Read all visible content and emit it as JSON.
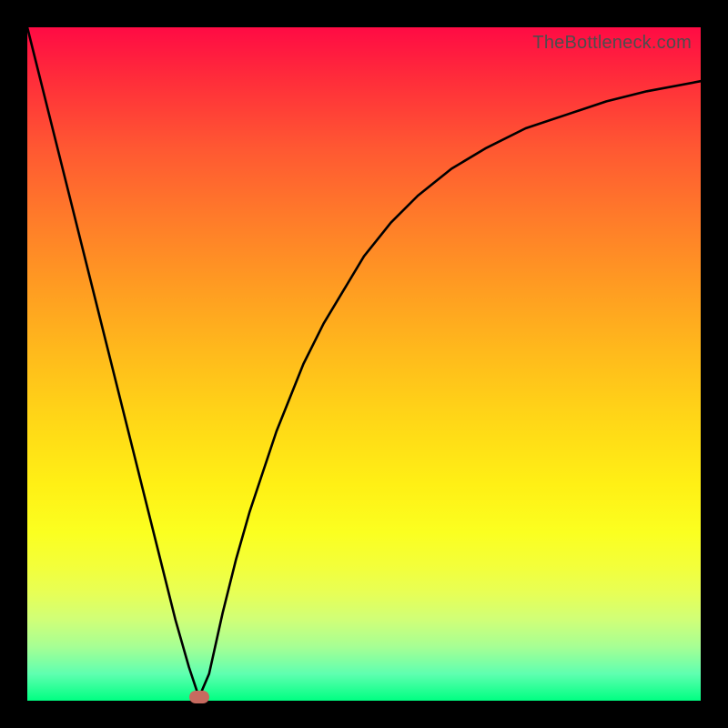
{
  "attribution": "TheBottleneck.com",
  "colors": {
    "frame": "#000000",
    "attribution_text": "#4d4d4d",
    "curve": "#000000",
    "marker": "#c76a5f",
    "gradient_top": "#ff0b44",
    "gradient_bottom": "#00ff82"
  },
  "chart_data": {
    "type": "line",
    "title": "",
    "xlabel": "",
    "ylabel": "",
    "xlim": [
      0,
      100
    ],
    "ylim": [
      0,
      100
    ],
    "grid": false,
    "legend": false,
    "annotations": [],
    "series": [
      {
        "name": "bottleneck-curve",
        "x": [
          0,
          2,
          4,
          6,
          8,
          10,
          12,
          14,
          16,
          18,
          20,
          22,
          24,
          25.5,
          27,
          29,
          31,
          33,
          35,
          37,
          39,
          41,
          44,
          47,
          50,
          54,
          58,
          63,
          68,
          74,
          80,
          86,
          92,
          100
        ],
        "y": [
          100,
          92,
          84,
          76,
          68,
          60,
          52,
          44,
          36,
          28,
          20,
          12,
          5,
          0.5,
          4,
          13,
          21,
          28,
          34,
          40,
          45,
          50,
          56,
          61,
          66,
          71,
          75,
          79,
          82,
          85,
          87,
          89,
          90.5,
          92
        ]
      }
    ],
    "marker": {
      "x": 25.5,
      "y": 0.5,
      "shape": "pill",
      "color": "#c76a5f"
    },
    "background_gradient": {
      "direction": "vertical",
      "stops": [
        {
          "pos": 0.0,
          "color": "#ff0b44"
        },
        {
          "pos": 0.5,
          "color": "#ffbd1a"
        },
        {
          "pos": 0.75,
          "color": "#fbff20"
        },
        {
          "pos": 1.0,
          "color": "#00ff82"
        }
      ]
    }
  }
}
